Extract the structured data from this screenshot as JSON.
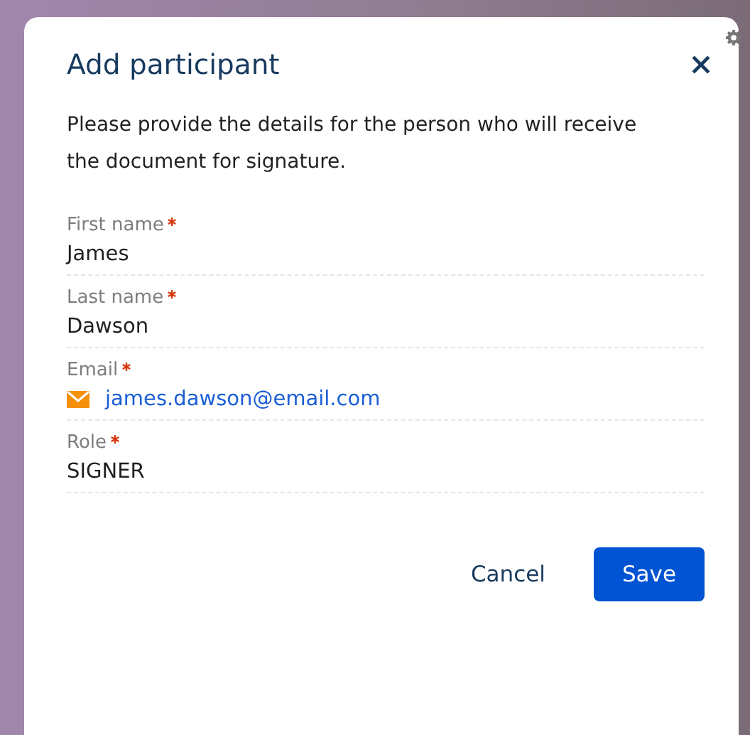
{
  "dialog": {
    "title": "Add participant",
    "description": "Please provide the details for the person who will receive the document for signature.",
    "fields": [
      {
        "kind": "text",
        "label": "First name",
        "required": true,
        "value": "James"
      },
      {
        "kind": "text",
        "label": "Last name",
        "required": true,
        "value": "Dawson"
      },
      {
        "kind": "email",
        "label": "Email",
        "required": true,
        "value": "james.dawson@email.com"
      },
      {
        "kind": "text",
        "label": "Role",
        "required": true,
        "value": "SIGNER"
      }
    ],
    "buttons": [
      {
        "kind": "secondary",
        "label": "Cancel"
      },
      {
        "kind": "primary",
        "label": "Save"
      }
    ]
  }
}
